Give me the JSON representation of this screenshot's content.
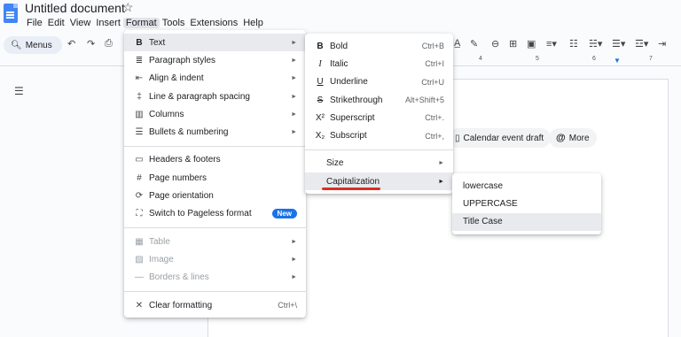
{
  "header": {
    "title": "Untitled document",
    "star": "☆",
    "menus": [
      "File",
      "Edit",
      "View",
      "Insert",
      "Format",
      "Tools",
      "Extensions",
      "Help"
    ]
  },
  "toolbar": {
    "menus_label": "Menus"
  },
  "chips": {
    "calendar": "Calendar event draft",
    "more": "More"
  },
  "ruler": {
    "ticks": [
      "4",
      "5",
      "6",
      "7"
    ]
  },
  "format_menu": {
    "items": [
      {
        "icon": "B",
        "label": "Text",
        "arrow": "►"
      },
      {
        "icon": "≣",
        "label": "Paragraph styles",
        "arrow": "►"
      },
      {
        "icon": "⇤",
        "label": "Align & indent",
        "arrow": "►"
      },
      {
        "icon": "‡",
        "label": "Line & paragraph spacing",
        "arrow": "►"
      },
      {
        "icon": "▥",
        "label": "Columns",
        "arrow": "►"
      },
      {
        "icon": "☰",
        "label": "Bullets & numbering",
        "arrow": "►"
      },
      {
        "icon": "▭",
        "label": "Headers & footers"
      },
      {
        "icon": "#",
        "label": "Page numbers"
      },
      {
        "icon": "⟳",
        "label": "Page orientation"
      },
      {
        "icon": "⛶",
        "label": "Switch to Pageless format",
        "badge": "New"
      },
      {
        "icon": "▦",
        "label": "Table",
        "arrow": "►"
      },
      {
        "icon": "▨",
        "label": "Image",
        "arrow": "►"
      },
      {
        "icon": "—",
        "label": "Borders & lines",
        "arrow": "►"
      },
      {
        "icon": "✕",
        "label": "Clear formatting",
        "shortcut": "Ctrl+\\"
      }
    ]
  },
  "text_menu": {
    "items": [
      {
        "icon": "B",
        "label": "Bold",
        "shortcut": "Ctrl+B"
      },
      {
        "icon": "I",
        "label": "Italic",
        "shortcut": "Ctrl+I"
      },
      {
        "icon": "U",
        "label": "Underline",
        "shortcut": "Ctrl+U"
      },
      {
        "icon": "S",
        "label": "Strikethrough",
        "shortcut": "Alt+Shift+5"
      },
      {
        "icon": "X²",
        "label": "Superscript",
        "shortcut": "Ctrl+."
      },
      {
        "icon": "X₂",
        "label": "Subscript",
        "shortcut": "Ctrl+,"
      },
      {
        "label": "Size",
        "arrow": "►"
      },
      {
        "label": "Capitalization",
        "arrow": "►"
      }
    ]
  },
  "cap_menu": {
    "items": [
      "lowercase",
      "UPPERCASE",
      "Title Case"
    ]
  }
}
